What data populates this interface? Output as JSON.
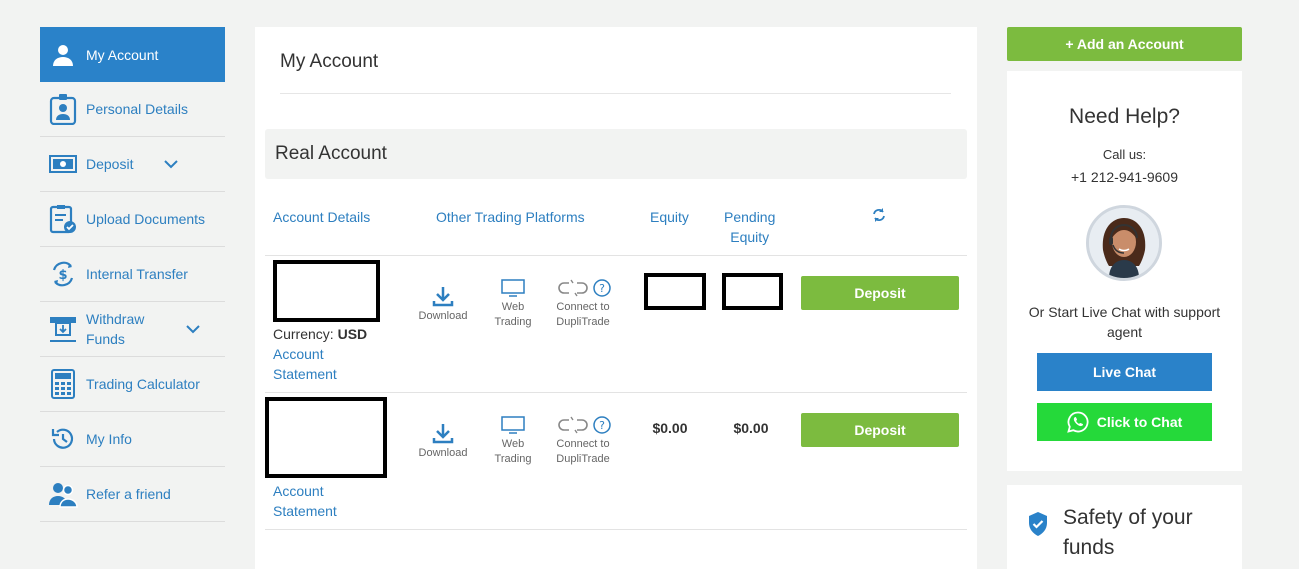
{
  "sidebar": {
    "items": [
      {
        "label": "My Account",
        "icon": "user-icon"
      },
      {
        "label": "Personal Details",
        "icon": "id-badge-icon"
      },
      {
        "label": "Deposit",
        "icon": "cash-icon"
      },
      {
        "label": "Upload Documents",
        "icon": "clipboard-check-icon"
      },
      {
        "label": "Internal Transfer",
        "icon": "dollar-transfer-icon"
      },
      {
        "label": "Withdraw",
        "label2": "Funds",
        "icon": "withdraw-icon"
      },
      {
        "label": "Trading Calculator",
        "icon": "calculator-icon"
      },
      {
        "label": "My Info",
        "icon": "history-icon"
      },
      {
        "label": "Refer a friend",
        "icon": "users-icon"
      }
    ]
  },
  "main": {
    "title": "My Account",
    "section_title": "Real Account",
    "columns": {
      "account_details": "Account Details",
      "other_platforms": "Other Trading Platforms",
      "equity": "Equity",
      "pending_1": "Pending",
      "pending_2": "Equity"
    },
    "platforms": {
      "download": "Download",
      "web_1": "Web",
      "web_2": "Trading",
      "connect_1": "Connect to",
      "connect_2": "DupliTrade"
    },
    "rows": [
      {
        "currency_label": "Currency:",
        "currency": "USD",
        "statement_1": "Account",
        "statement_2": "Statement",
        "equity": "",
        "pending": "",
        "deposit_label": "Deposit"
      },
      {
        "statement_1": "Account",
        "statement_2": "Statement",
        "equity": "$0.00",
        "pending": "$0.00",
        "deposit_label": "Deposit"
      }
    ]
  },
  "right": {
    "add_account": "+ Add an Account",
    "help_title": "Need Help?",
    "call_us": "Call us:",
    "phone": "+1 212-941-9609",
    "chat_text": "Or Start Live Chat with support agent",
    "live_chat": "Live Chat",
    "click_to_chat": "Click to Chat",
    "safety_title": "Safety of your funds"
  },
  "colors": {
    "primary": "#2a82c9",
    "green": "#7cbb3f",
    "whatsapp": "#25d93a"
  }
}
